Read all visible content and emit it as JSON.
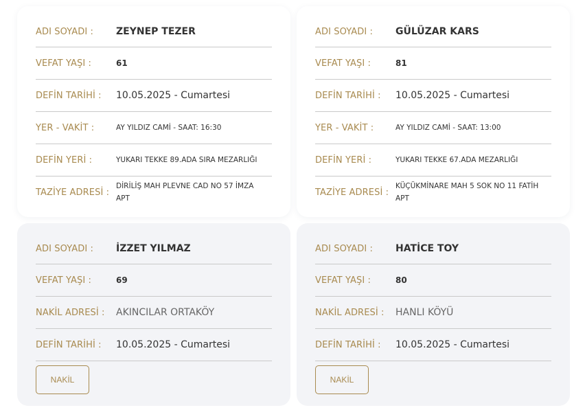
{
  "labels": {
    "name": "ADI SOYADI :",
    "age": "VEFAT YAŞI :",
    "burial_date": "DEFİN TARİHİ :",
    "place_time": "YER - VAKİT :",
    "burial_place": "DEFİN YERİ :",
    "condolence_address": "TAZİYE ADRESİ :",
    "transfer_address": "NAKİL ADRESİ :"
  },
  "cards": [
    {
      "name": "ZEYNEP TEZER",
      "age": "61",
      "burial_date": "10.05.2025 - Cumartesi",
      "place_time": "AY YILDIZ CAMİ - SAAT: 16:30",
      "burial_place": "YUKARI TEKKE 89.ADA SIRA MEZARLIĞI",
      "condolence_address": "DİRİLİŞ MAH PLEVNE CAD NO 57 İMZA APT"
    },
    {
      "name": "GÜLÜZAR KARS",
      "age": "81",
      "burial_date": "10.05.2025 - Cumartesi",
      "place_time": "AY YILDIZ CAMİ - SAAT: 13:00",
      "burial_place": "YUKARI TEKKE 67.ADA MEZARLIĞI",
      "condolence_address": "KÜÇÜKMİNARE MAH 5 SOK NO 11 FATİH APT"
    },
    {
      "name": "İZZET YILMAZ",
      "age": "69",
      "transfer_address": "AKINCILAR ORTAKÖY",
      "burial_date": "10.05.2025 - Cumartesi",
      "button": "NAKİL"
    },
    {
      "name": "HATİCE TOY",
      "age": "80",
      "transfer_address": "HANLI KÖYÜ",
      "burial_date": "10.05.2025 - Cumartesi",
      "button": "NAKİL"
    }
  ],
  "colors": {
    "label_gold": "#a88a4f",
    "grey_card_bg": "#f3f4f7",
    "divider": "#c9c9c9"
  }
}
